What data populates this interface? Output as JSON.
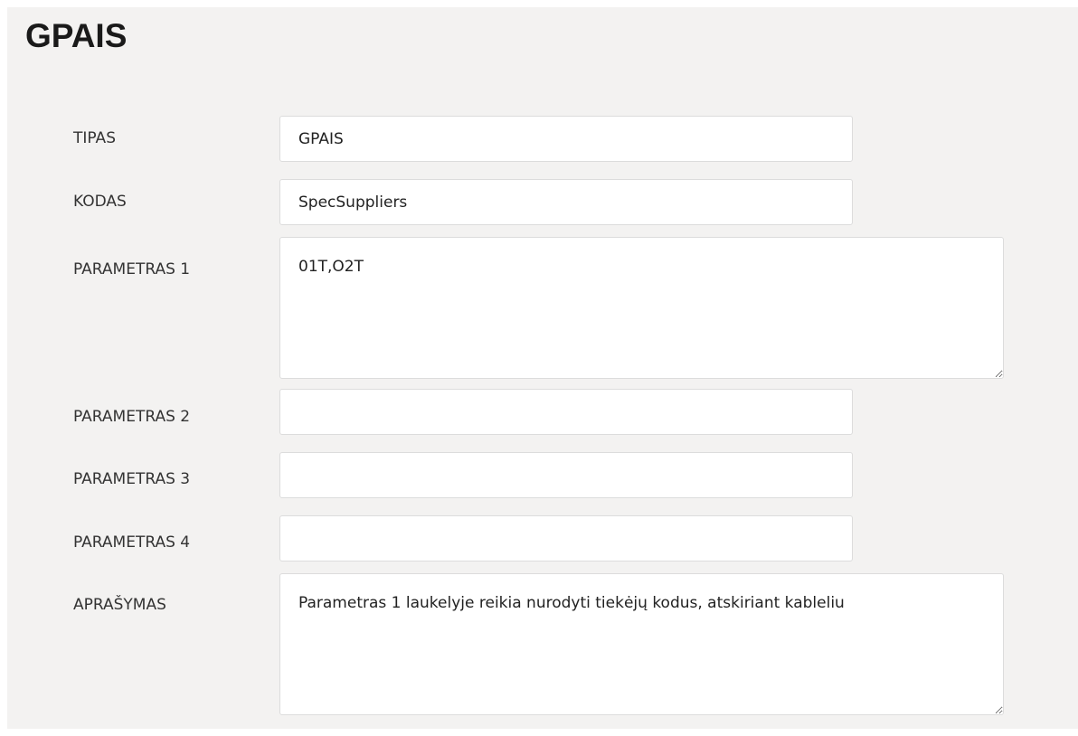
{
  "page": {
    "title": "GPAIS"
  },
  "form": {
    "tipas": {
      "label": "TIPAS",
      "value": "GPAIS"
    },
    "kodas": {
      "label": "KODAS",
      "value": "SpecSuppliers"
    },
    "parametras1": {
      "label": "PARAMETRAS 1",
      "value": "01T,O2T"
    },
    "parametras2": {
      "label": "PARAMETRAS 2",
      "value": ""
    },
    "parametras3": {
      "label": "PARAMETRAS 3",
      "value": ""
    },
    "parametras4": {
      "label": "PARAMETRAS 4",
      "value": ""
    },
    "aprasymas": {
      "label": "APRAŠYMAS",
      "value": "Parametras 1 laukelyje reikia nurodyti tiekėjų kodus, atskiriant kableliu"
    }
  }
}
